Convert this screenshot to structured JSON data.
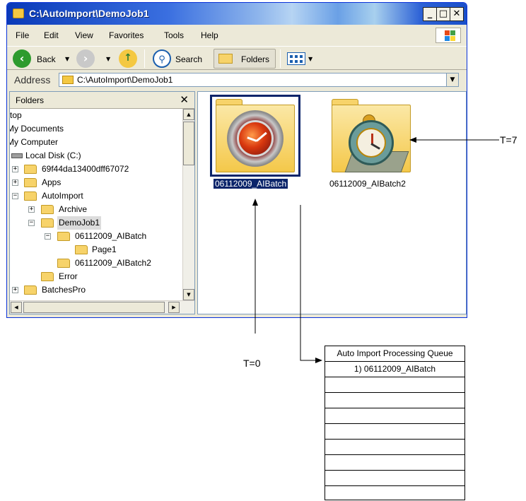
{
  "window": {
    "title": "C:\\AutoImport\\DemoJob1",
    "min_label": "_",
    "max_label": "□",
    "close_label": "✕"
  },
  "menu": [
    "File",
    "Edit",
    "View",
    "Favorites",
    "Tools",
    "Help"
  ],
  "toolbar": {
    "back_label": "Back",
    "search_label": "Search",
    "folders_label": "Folders"
  },
  "address": {
    "label": "Address",
    "value": "C:\\AutoImport\\DemoJob1"
  },
  "folders_pane": {
    "title": "Folders",
    "close_label": "✕",
    "tree": [
      {
        "label": "ktop"
      },
      {
        "label": "My Documents"
      },
      {
        "label": "My Computer"
      },
      {
        "label": "Local Disk (C:)"
      },
      {
        "label": "69f44da13400dff67072",
        "expander": "+"
      },
      {
        "label": "Apps",
        "expander": "+"
      },
      {
        "label": "AutoImport",
        "expander": "−"
      },
      {
        "label": "Archive",
        "expander": "+"
      },
      {
        "label": "DemoJob1",
        "expander": "−",
        "selected": true
      },
      {
        "label": "06112009_AIBatch",
        "expander": "−"
      },
      {
        "label": "Page1"
      },
      {
        "label": "06112009_AIBatch2"
      },
      {
        "label": "Error"
      },
      {
        "label": "BatchesPro",
        "expander": "+"
      }
    ]
  },
  "content": {
    "items": [
      {
        "label": "06112009_AIBatch",
        "icon": "processing-dial-icon",
        "selected": true
      },
      {
        "label": "06112009_AIBatch2",
        "icon": "alarm-clock-icon",
        "selected": false
      }
    ]
  },
  "annotations": {
    "t7_label": "T=7",
    "t0_label": "T=0"
  },
  "queue": {
    "header": "Auto Import Processing Queue",
    "rows": [
      "1) 06112009_AIBatch",
      "",
      "",
      "",
      "",
      "",
      "",
      "",
      ""
    ]
  },
  "colors": {
    "title_bar": "#0a3ab8",
    "selection": "#0a246a",
    "window_face": "#ece9d8"
  }
}
